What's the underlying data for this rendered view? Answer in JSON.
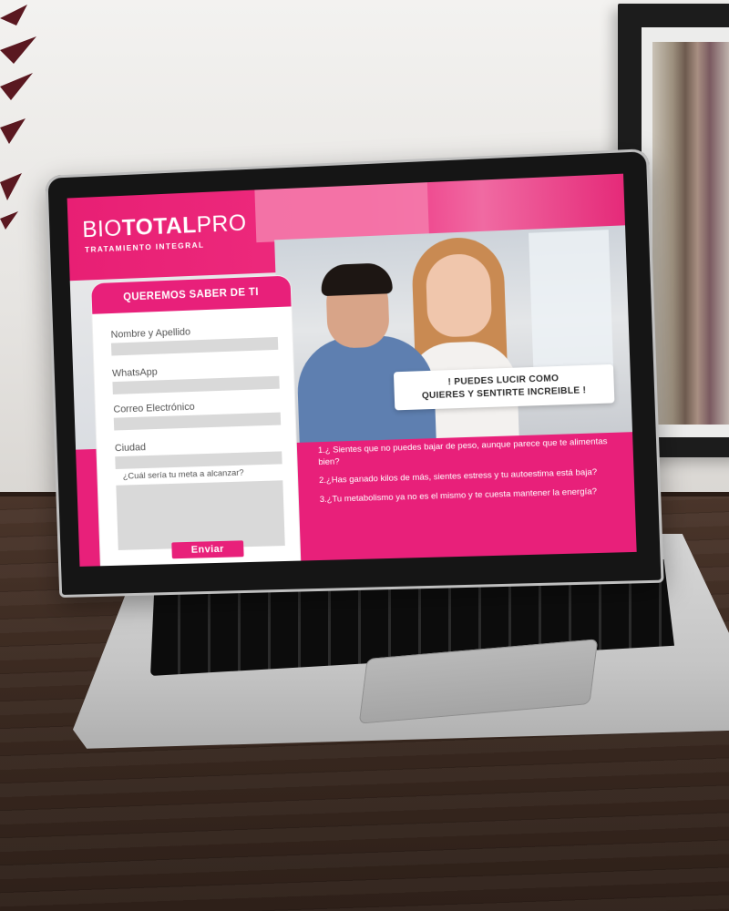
{
  "site": {
    "brand_regular": "BIO",
    "brand_bold": "TOTAL",
    "brand_suffix": "PRO",
    "tagline": "TRATAMIENTO INTEGRAL",
    "callout_line1": "! PUEDES LUCIR COMO",
    "callout_line2": "QUIERES Y SENTIRTE INCREIBLE !",
    "form": {
      "title": "QUEREMOS SABER DE TI",
      "fields": [
        {
          "label": "Nombre y Apellido",
          "value": ""
        },
        {
          "label": "WhatsApp",
          "value": ""
        },
        {
          "label": "Correo Electrónico",
          "value": ""
        },
        {
          "label": "Ciudad",
          "value": ""
        }
      ],
      "goal_label": "¿Cuál sería tu meta a alcanzar?",
      "goal_value": "",
      "submit_label": "Enviar"
    },
    "questions": [
      "1.¿ Sientes que no puedes bajar de peso, aunque parece que te alimentas bien?",
      "2.¿Has ganado kilos de más, sientes estress y tu autoestima está baja?",
      "3.¿Tu metabolismo ya no es el mismo y te cuesta mantener la energía?"
    ]
  },
  "colors": {
    "brand_pink": "#e8207a",
    "input_gray": "#d9d9d9",
    "laptop_bezel": "#151515",
    "desk_wood": "#3a2920"
  }
}
